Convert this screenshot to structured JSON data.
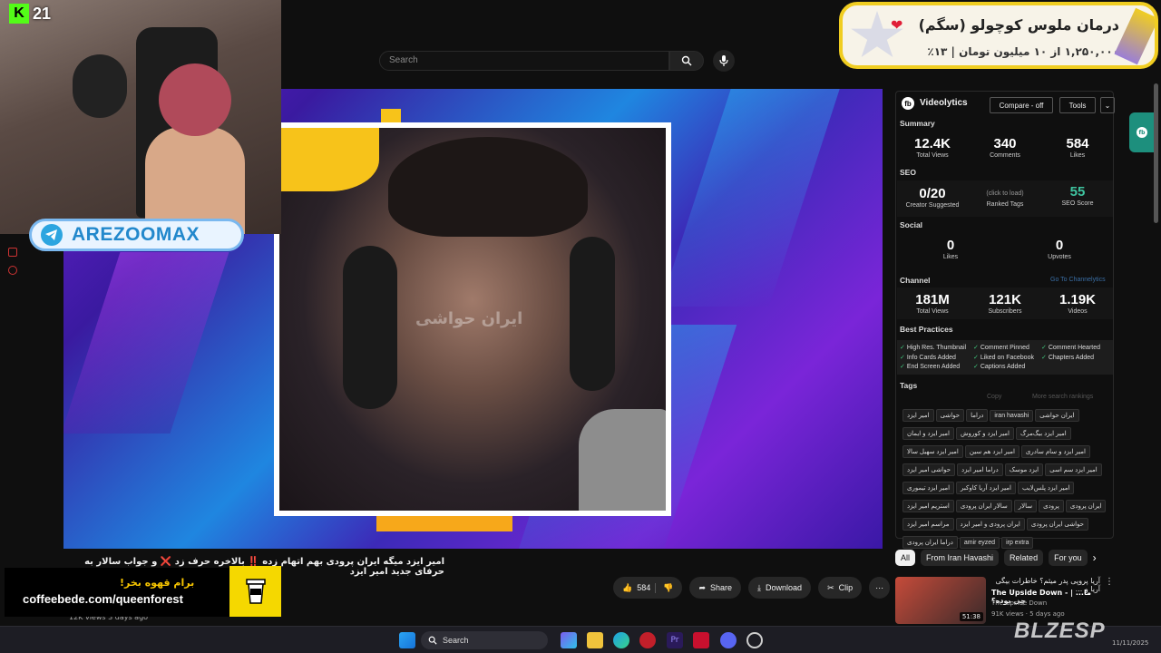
{
  "header": {
    "search_placeholder": "Search"
  },
  "player": {
    "watermark": "ایران حواشی"
  },
  "streamer": {
    "platform_count": "21",
    "telegram_handle": "AREZOOMAX"
  },
  "donation": {
    "title": "درمان ملوس کوچولو (سگم)",
    "progress_text": "۱,۲۵۰,۰۰۰ از ۱۰ میلیون تومان | ۱۳٪"
  },
  "videolytics": {
    "title": "Videolytics",
    "compare_label": "Compare - off",
    "tools_label": "Tools",
    "summary_label": "Summary",
    "summary": [
      {
        "value": "12.4K",
        "label": "Total Views"
      },
      {
        "value": "340",
        "label": "Comments"
      },
      {
        "value": "584",
        "label": "Likes"
      }
    ],
    "seo_label": "SEO",
    "seo": {
      "creator_value": "0/20",
      "creator_label": "Creator Suggested",
      "ranked_hint": "(click to load)",
      "ranked_label": "Ranked Tags",
      "score_value": "55",
      "score_label": "SEO Score"
    },
    "social_label": "Social",
    "social": [
      {
        "value": "0",
        "label": "Likes"
      },
      {
        "value": "0",
        "label": "Upvotes"
      }
    ],
    "channel_label": "Channel",
    "channel_link": "Go To Channelytics",
    "channel": [
      {
        "value": "181M",
        "label": "Total Views"
      },
      {
        "value": "121K",
        "label": "Subscribers"
      },
      {
        "value": "1.19K",
        "label": "Videos"
      }
    ],
    "best_practices_label": "Best Practices",
    "best_practices": [
      "High Res. Thumbnail",
      "Comment Pinned",
      "Comment Hearted",
      "Info Cards Added",
      "Liked on Facebook",
      "Chapters Added",
      "End Screen Added",
      "Captions Added"
    ],
    "tags_label": "Tags",
    "tags_copy": "Copy",
    "tags_more": "More search rankings",
    "tags": [
      "امیر ایزد",
      "حواشی",
      "دراما",
      "iran havashi",
      "ایران حواشی",
      "امیر ایزد و ایمان",
      "امیر ایزد و کوروش",
      "امیر ایزد بیگ‌مرگ",
      "امیر ایزد سهیل سالا",
      "امیر ایزد هم سین",
      "امیر ایزد و سام سادری",
      "حواشی امیر ایزد",
      "دراما امیر ایزد",
      "ایزد موسک",
      "امیر ایزد سم اسی",
      "امیر ایزد تیموری",
      "امیر ایزد آریا کاوکبر",
      "امیر ایزد پلس‌لایب",
      "استریم امیر ایزد",
      "سالار ایران پرودی",
      "سالار",
      "پرودی",
      "ایران پرودی",
      "مراسم امیر ایزد",
      "ایران پرودی و امیر ایزد",
      "حواشی ایران پرودی",
      "دراما ایران پرودی",
      "amir eyzed",
      "irp extra"
    ]
  },
  "chips": [
    "All",
    "From Iran Havashi",
    "Related",
    "For you"
  ],
  "recommended": {
    "title_fa": "آریا پروپی پدر میثم؟ خاطرات بیگی آریا و ...",
    "title_en": "The Upside Down - | ...ما چی بوده؟",
    "channel": "The Upside Down",
    "views": "91K views · 5 days ago",
    "duration": "51:38"
  },
  "video": {
    "title": "امیر ایزد میگه ایران پرودی بهم اتهام زده ‼️ بالاخره حرف زد ❌ و جواب سالار به حرفای جدید امیر ایزد",
    "meta": "12K views  3 days ago",
    "likes": "584",
    "share_label": "Share",
    "download_label": "Download",
    "clip_label": "Clip"
  },
  "coffee": {
    "heading": "برام قهوه بخر!",
    "url": "coffeebede.com/queenforest"
  },
  "taskbar": {
    "search_label": "Search",
    "date": "11/11/2025",
    "watermark": "BLZESP"
  }
}
